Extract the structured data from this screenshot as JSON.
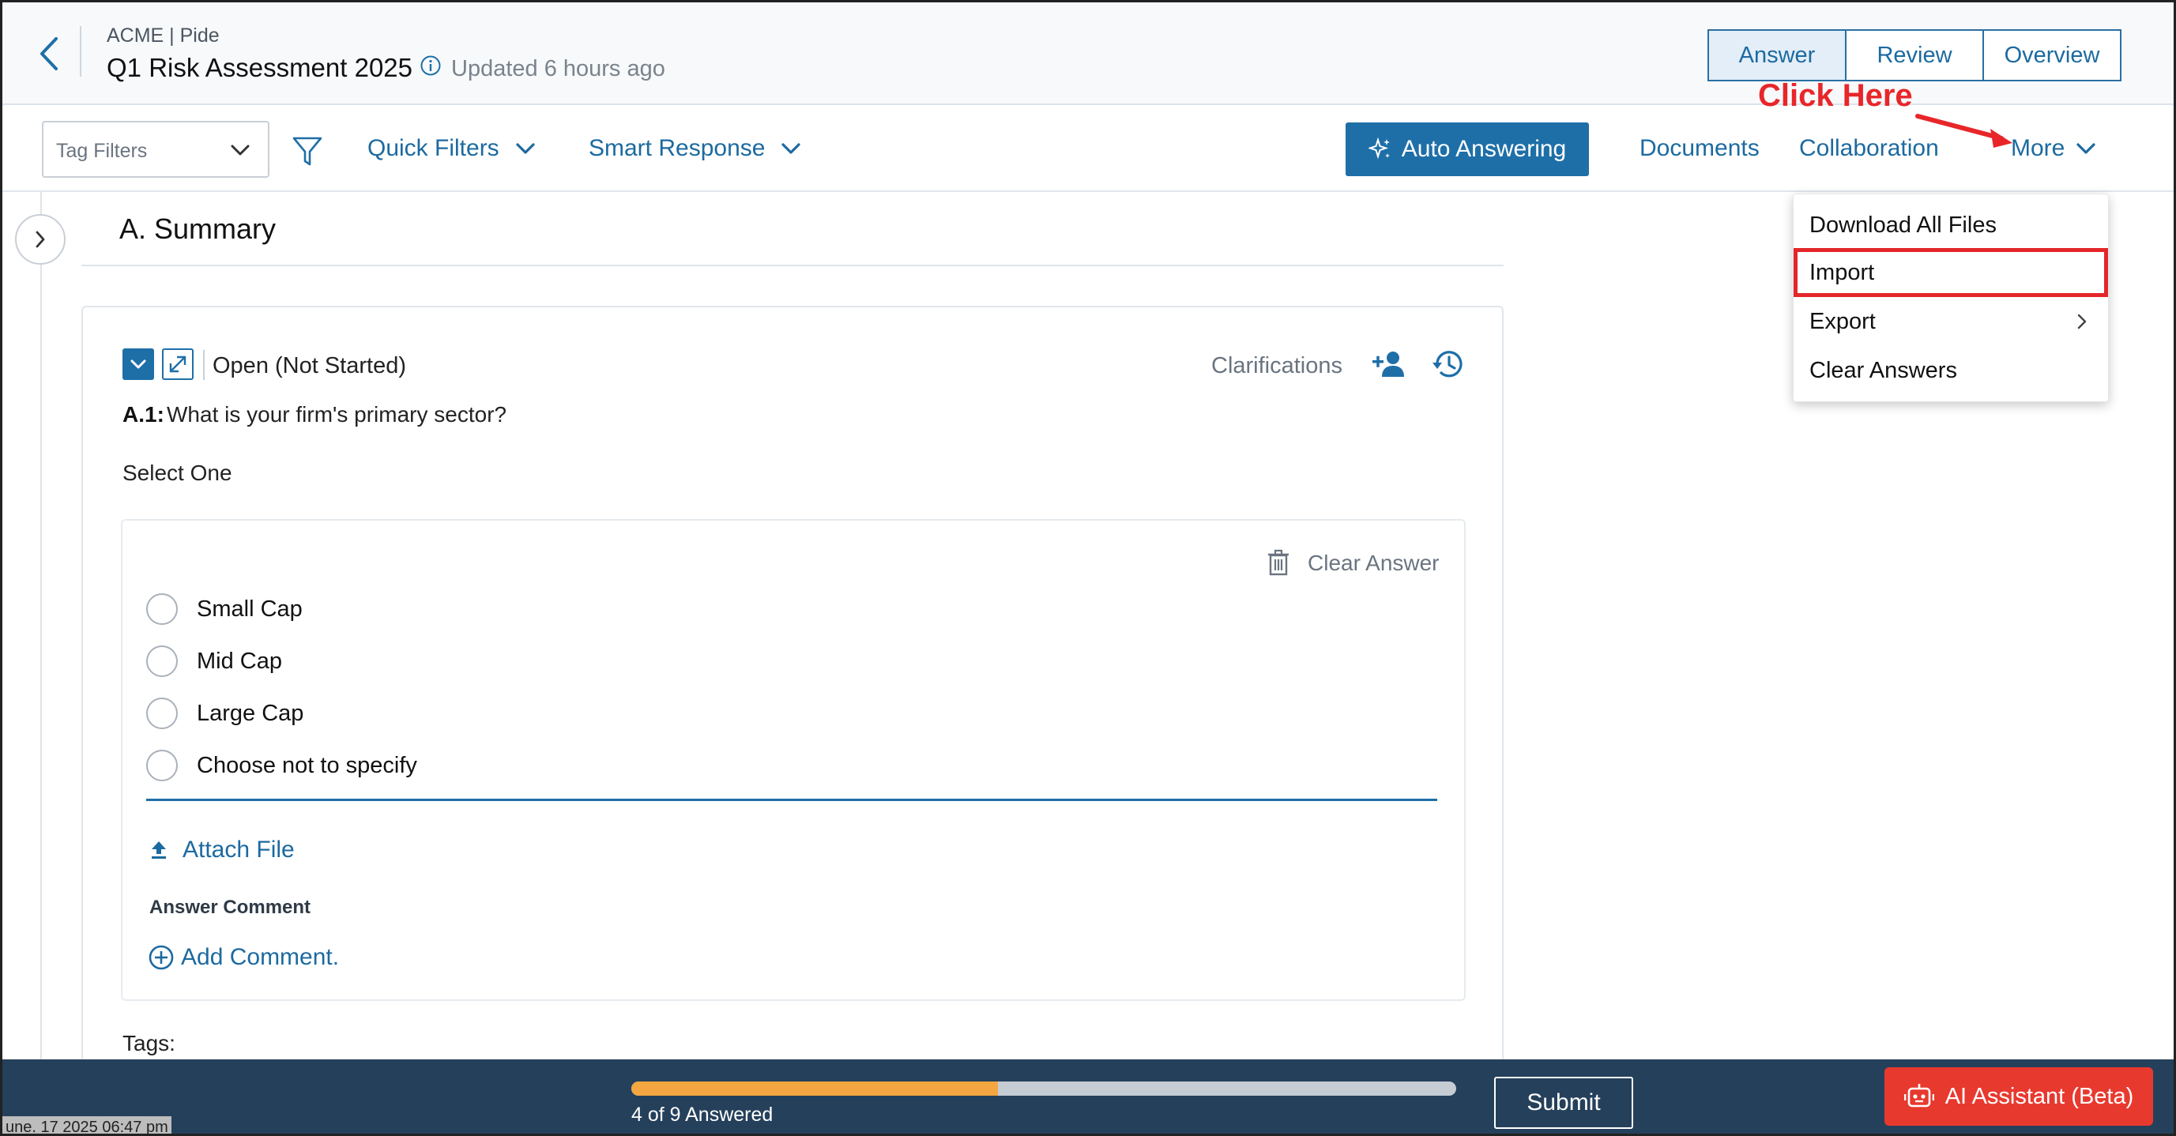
{
  "header": {
    "breadcrumb": "ACME | Pide",
    "title": "Q1 Risk Assessment 2025",
    "updated": "Updated 6 hours ago",
    "view_tabs": [
      {
        "label": "Answer",
        "active": true
      },
      {
        "label": "Review",
        "active": false
      },
      {
        "label": "Overview",
        "active": false
      }
    ]
  },
  "toolbar": {
    "tag_filter_placeholder": "Tag Filters",
    "quick_filters": "Quick Filters",
    "smart_response": "Smart Response",
    "auto_answering": "Auto Answering",
    "documents": "Documents",
    "collaboration": "Collaboration",
    "more": "More"
  },
  "annotation": {
    "text": "Click Here",
    "color": "#e8262a"
  },
  "more_menu": {
    "items": [
      {
        "label": "Download All Files",
        "highlighted": false,
        "has_submenu": false
      },
      {
        "label": "Import",
        "highlighted": true,
        "has_submenu": false
      },
      {
        "label": "Export",
        "highlighted": false,
        "has_submenu": true
      },
      {
        "label": "Clear Answers",
        "highlighted": false,
        "has_submenu": false
      }
    ]
  },
  "section": {
    "title": "A. Summary"
  },
  "question": {
    "status": "Open (Not Started)",
    "clarifications": "Clarifications",
    "number": "A.1:",
    "text": "What is your firm's primary sector?",
    "instruction": "Select One",
    "clear_answer": "Clear Answer",
    "options": [
      "Small Cap",
      "Mid Cap",
      "Large Cap",
      "Choose not to specify"
    ],
    "attach_file": "Attach File",
    "answer_comment_label": "Answer Comment",
    "add_comment": "Add Comment.",
    "tags_label": "Tags:"
  },
  "footer": {
    "answered": 4,
    "total": 9,
    "progress_label": "4 of 9 Answered",
    "submit": "Submit",
    "ai_assistant": "AI Assistant (Beta)",
    "timestamp": "une. 17 2025 06:47 pm"
  },
  "colors": {
    "primary": "#1e6fa8",
    "footer_bg": "#25405b",
    "progress_fill": "#f4a640",
    "ai_button": "#e8392f",
    "highlight_border": "#e3262a"
  },
  "icons": {
    "back": "chevron-left-icon",
    "info": "info-icon",
    "filter": "funnel-icon",
    "auto_answering": "sparkle-icon",
    "rail_toggle": "chevron-right-icon",
    "assign": "person-add-icon",
    "history": "history-icon",
    "trash": "trash-icon",
    "attach": "upload-icon",
    "add_comment": "plus-circle-icon",
    "ai": "robot-icon"
  }
}
